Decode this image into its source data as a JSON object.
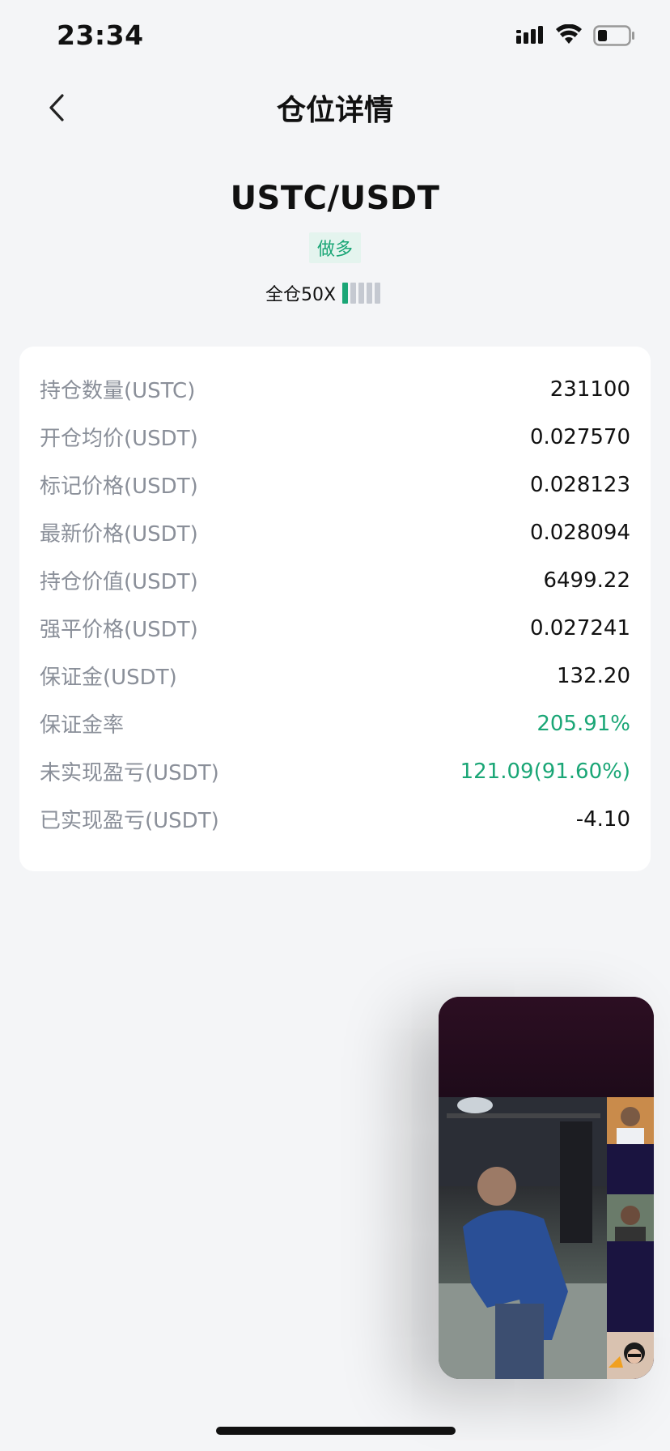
{
  "status_bar": {
    "time": "23:34"
  },
  "nav": {
    "title": "仓位详情"
  },
  "position": {
    "pair": "USTC/USDT",
    "side": "做多",
    "margin_mode_leverage": "全仓50X",
    "leverage_level": 0.2
  },
  "details": [
    {
      "label": "持仓数量(USTC)",
      "value": "231100"
    },
    {
      "label": "开仓均价(USDT)",
      "value": "0.027570"
    },
    {
      "label": "标记价格(USDT)",
      "value": "0.028123"
    },
    {
      "label": "最新价格(USDT)",
      "value": "0.028094"
    },
    {
      "label": "持仓价值(USDT)",
      "value": "6499.22"
    },
    {
      "label": "强平价格(USDT)",
      "value": "0.027241"
    },
    {
      "label": "保证金(USDT)",
      "value": "132.20"
    },
    {
      "label": "保证金率",
      "value": "205.91%"
    },
    {
      "label": "未实现盈亏(USDT)",
      "value": "121.09(91.60%)"
    },
    {
      "label": "已实现盈亏(USDT)",
      "value": "-4.10"
    }
  ],
  "colors": {
    "accent_green": "#1aa676",
    "label_gray": "#8a8f99"
  }
}
